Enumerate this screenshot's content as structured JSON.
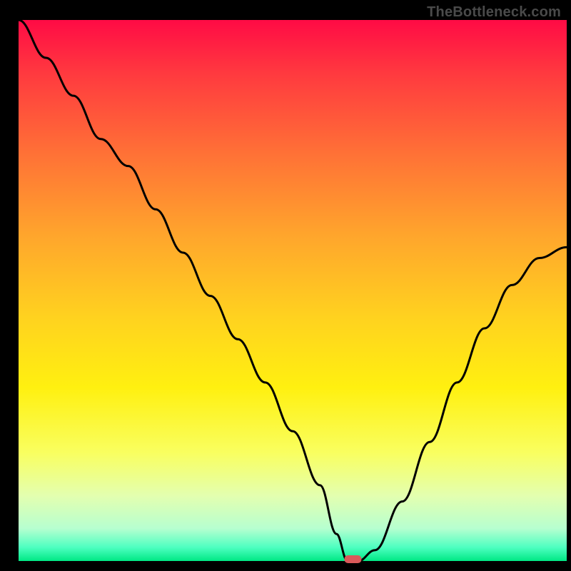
{
  "watermark": "TheBottleneck.com",
  "chart_data": {
    "type": "line",
    "title": "",
    "xlabel": "",
    "ylabel": "",
    "xlim": [
      0,
      100
    ],
    "ylim": [
      0,
      100
    ],
    "x": [
      0,
      5,
      10,
      15,
      20,
      25,
      30,
      35,
      40,
      45,
      50,
      55,
      58,
      60,
      62,
      65,
      70,
      75,
      80,
      85,
      90,
      95,
      100
    ],
    "values": [
      100,
      93,
      86,
      78,
      73,
      65,
      57,
      49,
      41,
      33,
      24,
      14,
      5,
      0,
      0,
      2,
      11,
      22,
      33,
      43,
      51,
      56,
      58
    ],
    "note": "V-shaped bottleneck curve; minimum (optimal point) around x≈60–62. Values are bottleneck percentage from 0 (green, bottom) to 100 (red, top).",
    "marker": {
      "x": 61,
      "y": 0
    },
    "gradient_stops": [
      {
        "offset": 0.0,
        "color": "#ff0b45"
      },
      {
        "offset": 0.1,
        "color": "#ff3a3f"
      },
      {
        "offset": 0.25,
        "color": "#ff7236"
      },
      {
        "offset": 0.4,
        "color": "#ffa62c"
      },
      {
        "offset": 0.55,
        "color": "#ffd21f"
      },
      {
        "offset": 0.68,
        "color": "#fff010"
      },
      {
        "offset": 0.8,
        "color": "#f9ff60"
      },
      {
        "offset": 0.88,
        "color": "#e3ffb0"
      },
      {
        "offset": 0.94,
        "color": "#b6ffd0"
      },
      {
        "offset": 0.975,
        "color": "#4dffc0"
      },
      {
        "offset": 1.0,
        "color": "#00e884"
      }
    ],
    "accent_marker_color": "#d95a5a",
    "line_color": "#000000",
    "frame_color": "#000000"
  }
}
